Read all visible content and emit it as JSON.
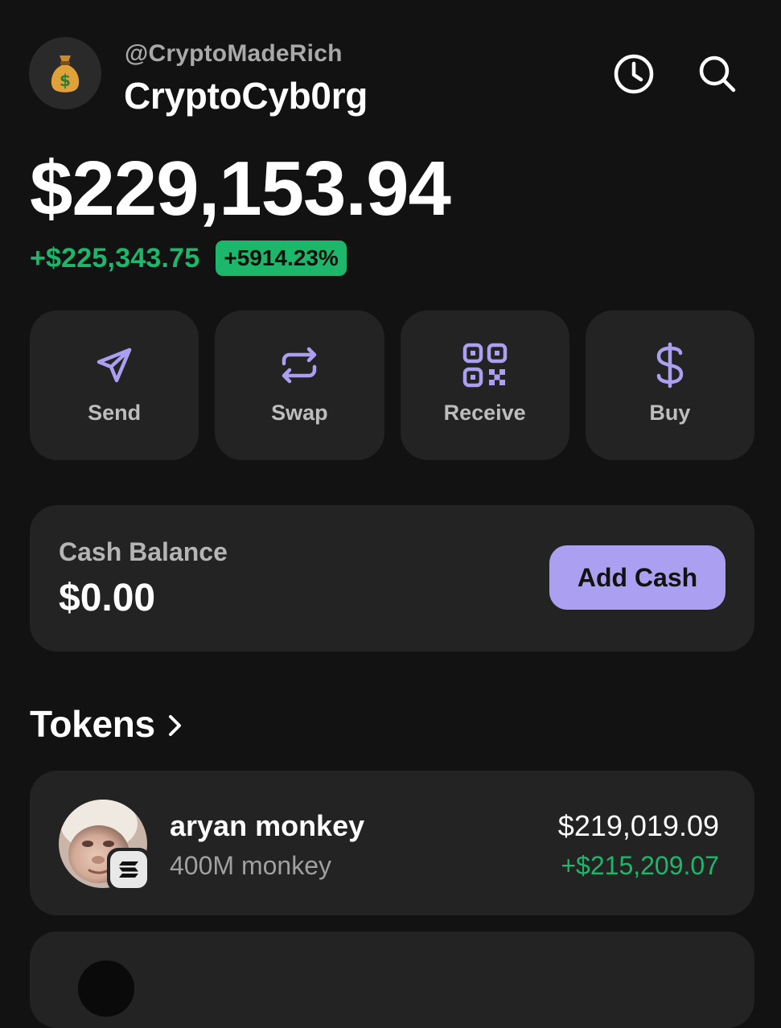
{
  "header": {
    "avatar_icon": "money-bag-icon",
    "handle": "@CryptoMadeRich",
    "username": "CryptoCyb0rg",
    "history_icon": "clock-icon",
    "search_icon": "search-icon"
  },
  "portfolio": {
    "balance": "$229,153.94",
    "change_amount": "+$225,343.75",
    "change_percent": "+5914.23%"
  },
  "actions": [
    {
      "label": "Send",
      "icon": "send-icon"
    },
    {
      "label": "Swap",
      "icon": "swap-icon"
    },
    {
      "label": "Receive",
      "icon": "qr-code-icon"
    },
    {
      "label": "Buy",
      "icon": "dollar-icon"
    }
  ],
  "cash": {
    "label": "Cash Balance",
    "value": "$0.00",
    "button_label": "Add Cash"
  },
  "tokens": {
    "title": "Tokens",
    "items": [
      {
        "name": "aryan monkey",
        "amount": "400M monkey",
        "value": "$219,019.09",
        "change": "+$215,209.07",
        "chain_icon": "solana-icon"
      }
    ]
  },
  "colors": {
    "background": "#121212",
    "card": "#232323",
    "accent": "#ab9ff2",
    "positive": "#1db76b"
  }
}
